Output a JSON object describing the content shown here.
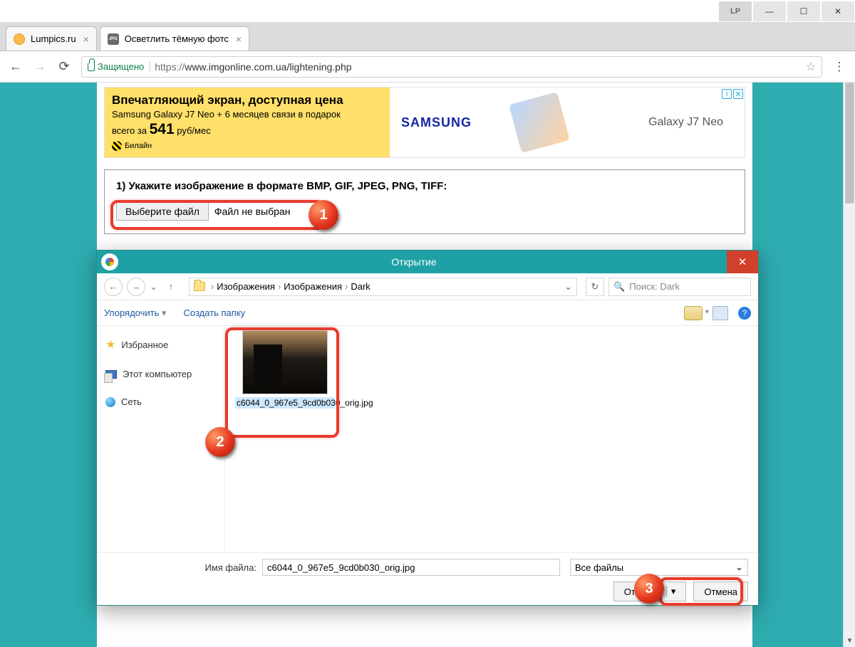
{
  "window": {
    "lp_badge": "LP",
    "minimize": "—",
    "maximize": "☐",
    "close": "✕"
  },
  "tabs": [
    {
      "title": "Lumpics.ru",
      "close": "×"
    },
    {
      "title": "Осветлить тёмную фотс",
      "close": "×"
    }
  ],
  "address": {
    "back": "←",
    "forward": "→",
    "reload": "⟳",
    "secure_label": "Защищено",
    "scheme": "https://",
    "url_rest": "www.imgonline.com.ua/lightening.php",
    "star": "☆",
    "menu": "⋮"
  },
  "ad": {
    "headline": "Впечатляющий экран, доступная цена",
    "sub": "Samsung Galaxy J7 Neo + 6 месяцев связи в подарок",
    "price_prefix": "всего за ",
    "price_value": "541",
    "price_suffix": " руб/мес",
    "beeline": "Билайн",
    "brand": "SAMSUNG",
    "model": "Galaxy J7 Neo",
    "info_i": "i",
    "info_x": "✕"
  },
  "form": {
    "step_label": "1) Укажите изображение в формате BMP, GIF, JPEG, PNG, TIFF:",
    "choose_file": "Выберите файл",
    "no_file": "Файл не выбран"
  },
  "badges": {
    "one": "1",
    "two": "2",
    "three": "3"
  },
  "dialog": {
    "title": "Открытие",
    "close": "✕",
    "nav_back": "←",
    "nav_fwd": "→",
    "nav_up": "↑",
    "crumbs": [
      "Изображения",
      "Изображения",
      "Dark"
    ],
    "crumb_sep": "›",
    "crumb_dd": "⌄",
    "refresh": "↻",
    "search_placeholder": "Поиск: Dark",
    "search_icon": "🔍",
    "organize": "Упорядочить",
    "new_folder": "Создать папку",
    "help": "?",
    "sidebar": {
      "favorites": "Избранное",
      "this_pc": "Этот компьютер",
      "network": "Сеть"
    },
    "file": {
      "name_display": "c6044_0_967е5_9сd0b030_orig.jpg"
    },
    "filename_label": "Имя файла:",
    "filename_value": "c6044_0_967е5_9сd0b030_orig.jpg",
    "filetype": "Все файлы",
    "filetype_dd": "⌄",
    "open": "Открыть",
    "open_dd": "▾",
    "cancel": "Отмена"
  }
}
